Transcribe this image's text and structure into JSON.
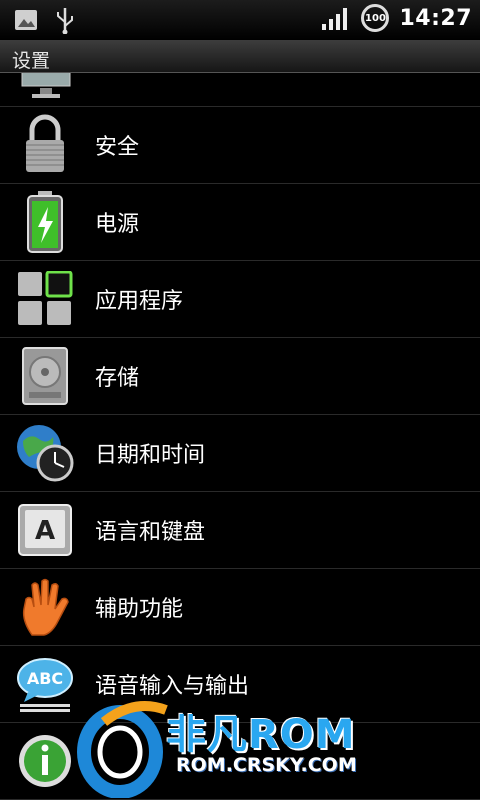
{
  "status_bar": {
    "time": "14:27",
    "battery_level": "100"
  },
  "header": {
    "title": "设置"
  },
  "settings_items": [
    {
      "label": "安全",
      "icon": "lock-icon"
    },
    {
      "label": "电源",
      "icon": "battery-icon"
    },
    {
      "label": "应用程序",
      "icon": "apps-icon"
    },
    {
      "label": "存储",
      "icon": "storage-icon"
    },
    {
      "label": "日期和时间",
      "icon": "globe-clock-icon"
    },
    {
      "label": "语言和键盘",
      "icon": "keyboard-key-icon"
    },
    {
      "label": "辅助功能",
      "icon": "hand-icon"
    },
    {
      "label": "语音输入与输出",
      "icon": "speech-bubble-icon"
    }
  ],
  "watermark": {
    "brand": "非凡ROM",
    "url": "ROM.CRSKY.COM"
  },
  "colors": {
    "background": "#000000",
    "divider": "#2a2a2a",
    "power_green": "#3fbf2a",
    "watermark_blue": "#2aa7f0"
  }
}
